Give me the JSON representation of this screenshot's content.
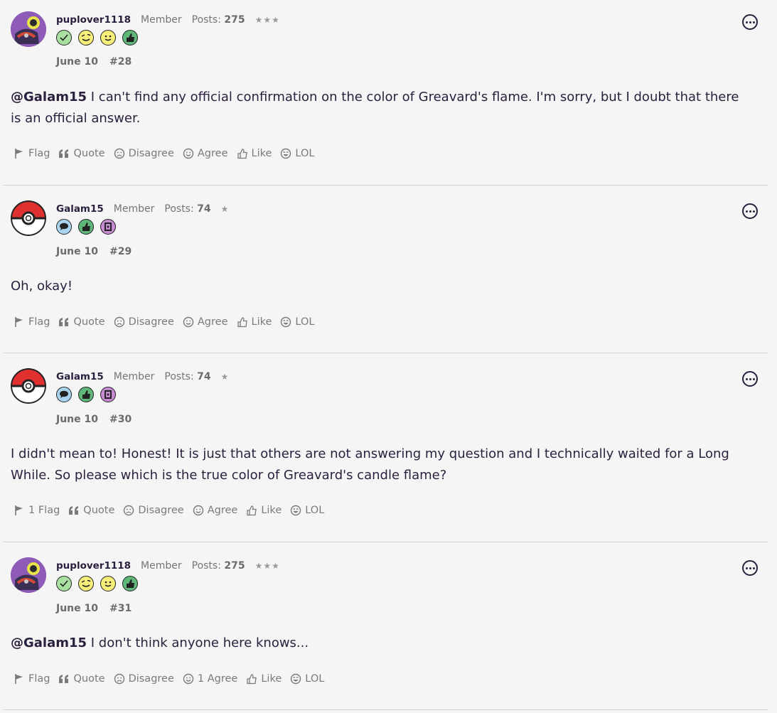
{
  "posts": [
    {
      "username": "puplover1118",
      "role": "Member",
      "posts_label": "Posts:",
      "posts_count": "275",
      "stars": "★★★",
      "badges": [
        "check",
        "wink",
        "smile",
        "thumb"
      ],
      "date": "June 10",
      "number": "#28",
      "mention": "@Galam15",
      "text": " I can't find any official confirmation on the color of Greavard's flame. I'm sorry, but I doubt that there is an official answer.",
      "actions": {
        "flag": "Flag",
        "quote": "Quote",
        "disagree": "Disagree",
        "agree": "Agree",
        "like": "Like",
        "lol": "LOL"
      },
      "avatar": "puplover"
    },
    {
      "username": "Galam15",
      "role": "Member",
      "posts_label": "Posts:",
      "posts_count": "74",
      "stars": "★",
      "badges": [
        "speech",
        "thumb",
        "book"
      ],
      "date": "June 10",
      "number": "#29",
      "mention": "",
      "text": "Oh, okay!",
      "actions": {
        "flag": "Flag",
        "quote": "Quote",
        "disagree": "Disagree",
        "agree": "Agree",
        "like": "Like",
        "lol": "LOL"
      },
      "avatar": "pokeball"
    },
    {
      "username": "Galam15",
      "role": "Member",
      "posts_label": "Posts:",
      "posts_count": "74",
      "stars": "★",
      "badges": [
        "speech",
        "thumb",
        "book"
      ],
      "date": "June 10",
      "number": "#30",
      "mention": "",
      "text": "I didn't mean to! Honest! It is just that others are not answering my question and I technically waited for a Long While. So please which is the true color of Greavard's candle flame?",
      "actions": {
        "flag": "1 Flag",
        "quote": "Quote",
        "disagree": "Disagree",
        "agree": "Agree",
        "like": "Like",
        "lol": "LOL"
      },
      "avatar": "pokeball"
    },
    {
      "username": "puplover1118",
      "role": "Member",
      "posts_label": "Posts:",
      "posts_count": "275",
      "stars": "★★★",
      "badges": [
        "check",
        "wink",
        "smile",
        "thumb"
      ],
      "date": "June 10",
      "number": "#31",
      "mention": "@Galam15",
      "text": " I don't think anyone here knows...",
      "actions": {
        "flag": "Flag",
        "quote": "Quote",
        "disagree": "Disagree",
        "agree": "1 Agree",
        "like": "Like",
        "lol": "LOL"
      },
      "avatar": "puplover"
    }
  ]
}
